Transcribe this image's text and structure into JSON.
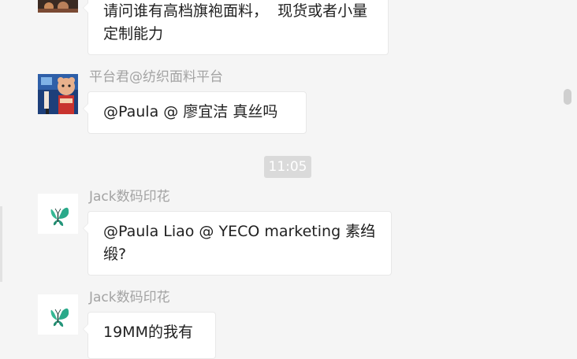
{
  "messages": [
    {
      "id": "m1",
      "text": "请问谁有高档旗袍面料，  现货或者小量定制能力"
    },
    {
      "id": "m2",
      "sender": "平台君@纺织面料平台",
      "text": "@Paula @ 廖宜洁 真丝吗"
    },
    {
      "id": "m3",
      "sender": "Jack数码印花",
      "text": "@Paula Liao @ YECO marketing 素绉缎?"
    },
    {
      "id": "m4",
      "sender": "Jack数码印花",
      "text": "19MM的我有"
    }
  ],
  "timestamp": "11:05",
  "avatars": {
    "platform": "platform-mascot-avatar",
    "jack": "butterfly-avatar"
  },
  "colors": {
    "background": "#f5f5f5",
    "bubble": "#ffffff",
    "sender_name": "#a3a3a3",
    "timestamp_bg": "#dadada",
    "butterfly": "#2aa98a"
  }
}
